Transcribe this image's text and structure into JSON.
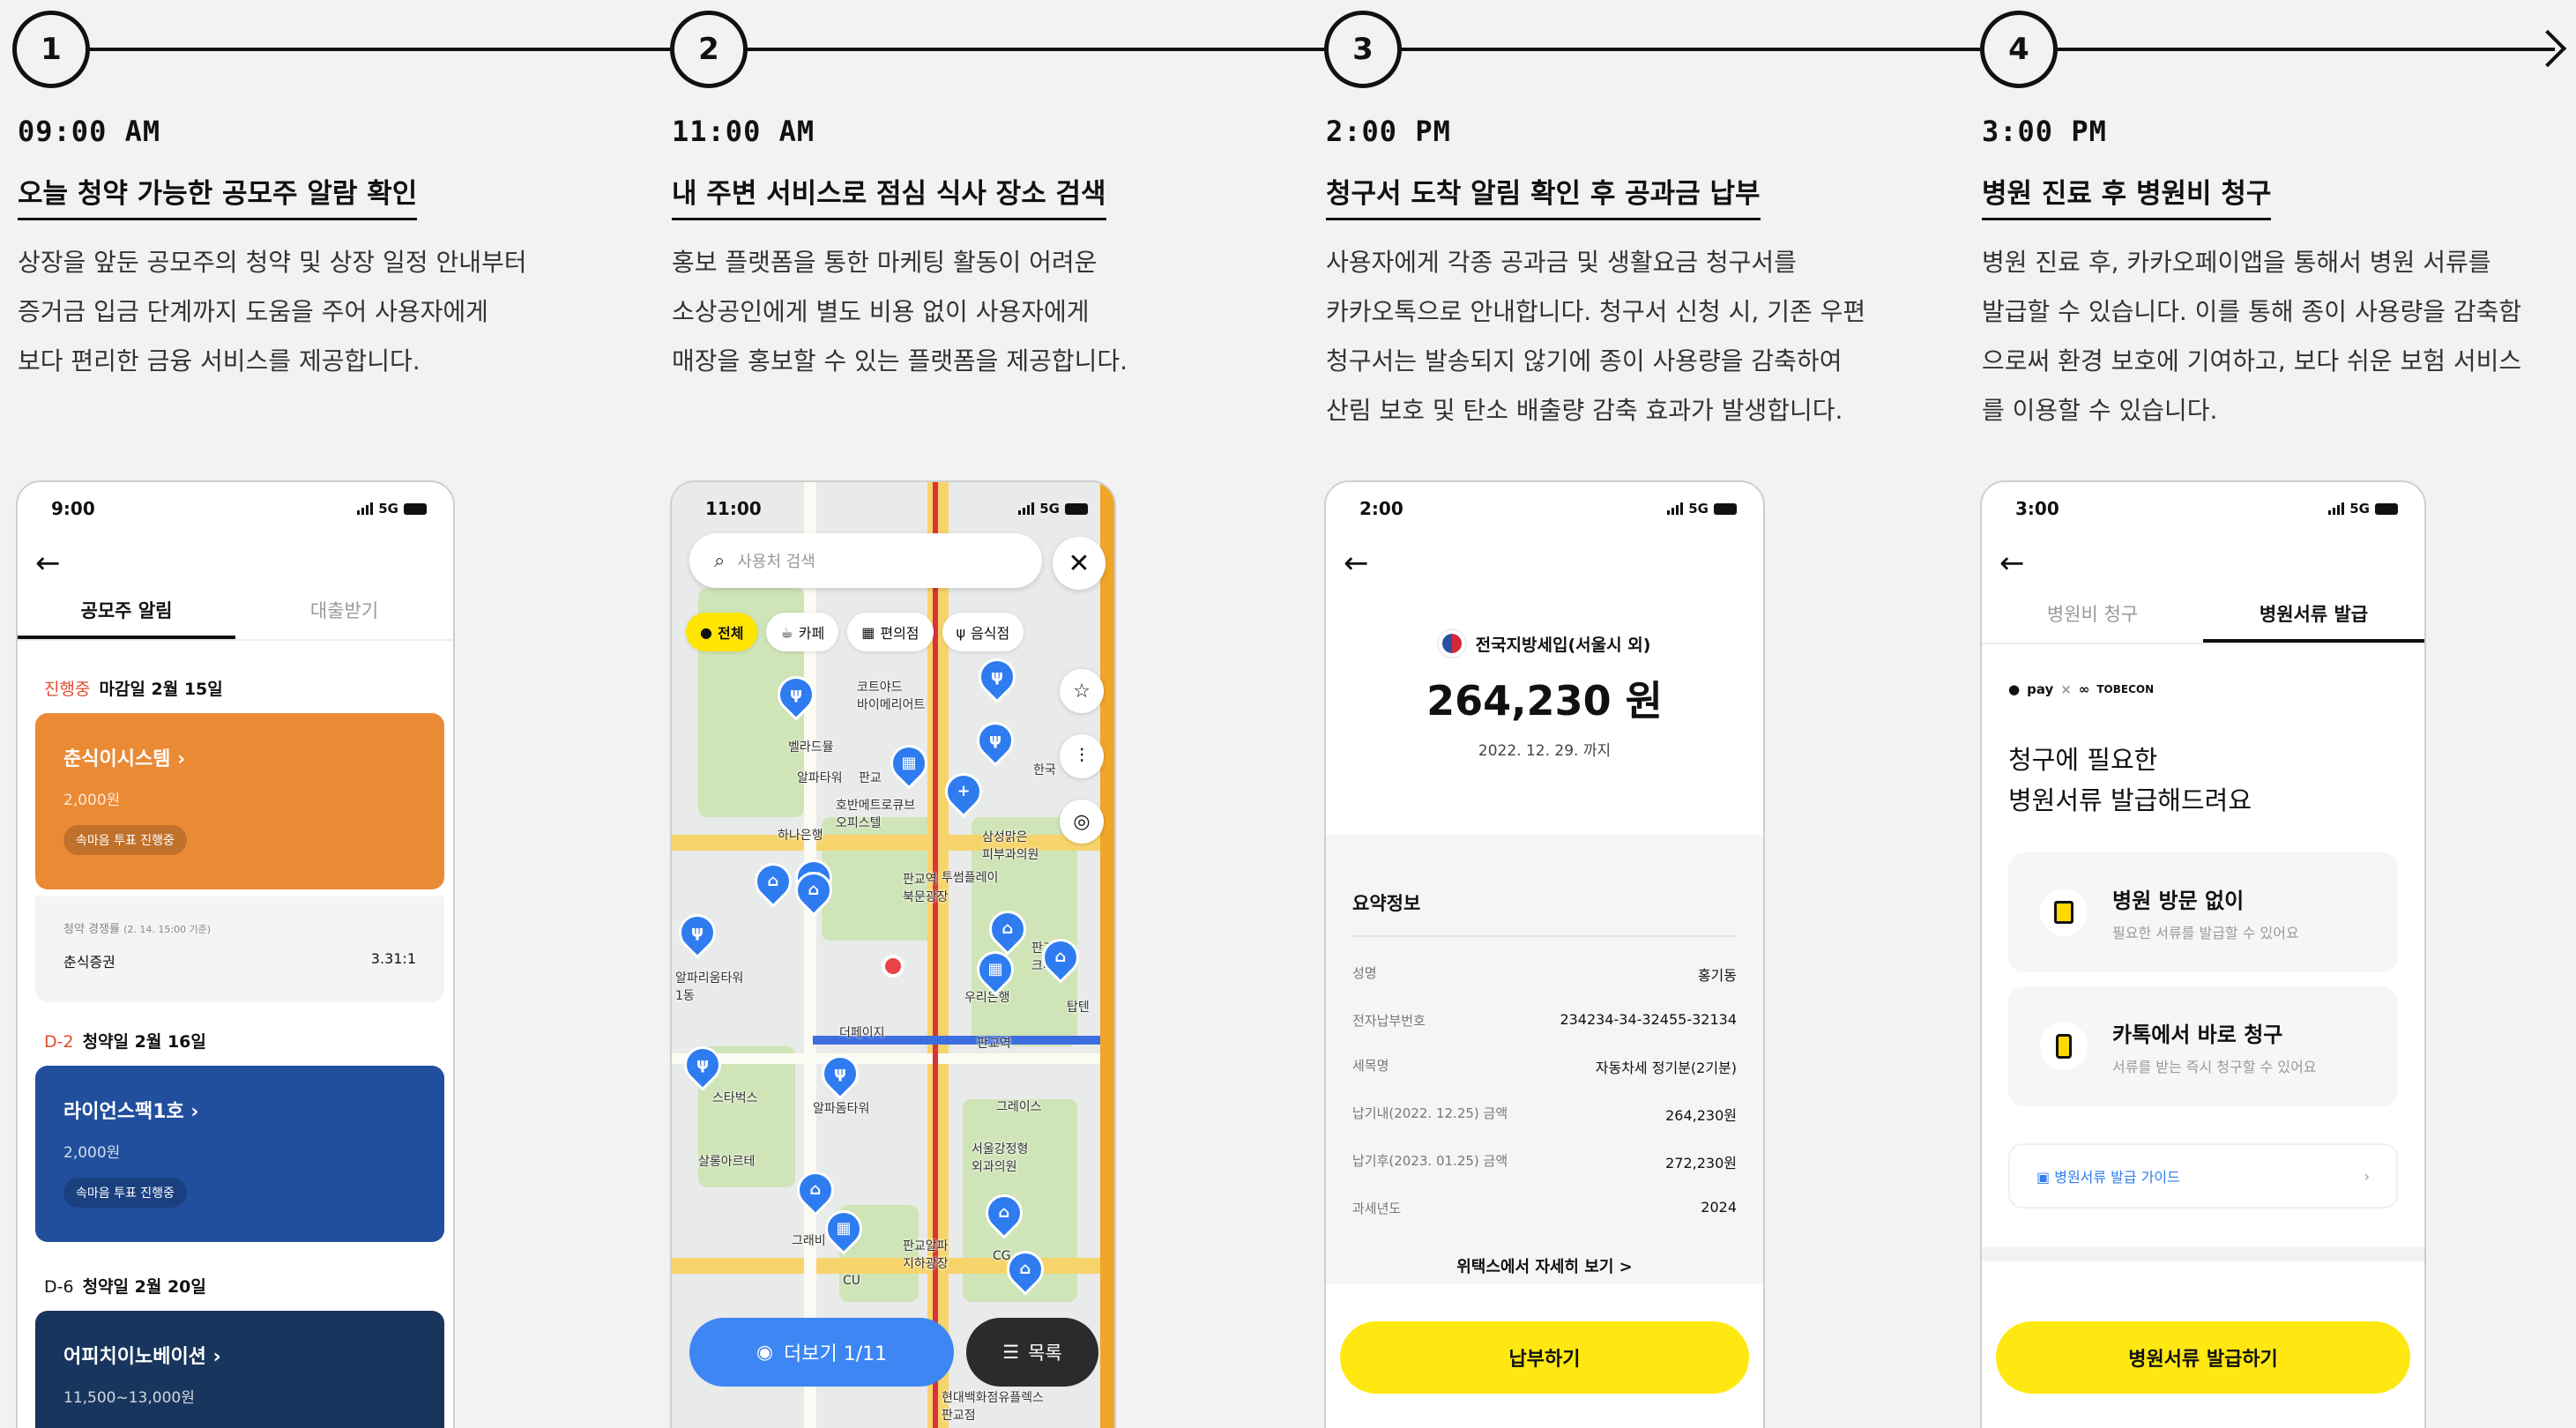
{
  "steps": [
    {
      "num": "1",
      "time": "09:00 AM",
      "title": "오늘 청약 가능한 공모주 알람 확인",
      "desc": [
        "상장을 앞둔 공모주의 청약 및 상장 일정 안내부터",
        "증거금 입금 단계까지 도움을 주어 사용자에게",
        "보다 편리한 금융 서비스를 제공합니다."
      ]
    },
    {
      "num": "2",
      "time": "11:00 AM",
      "title": "내 주변 서비스로 점심  식사 장소 검색",
      "desc": [
        "홍보 플랫폼을 통한 마케팅 활동이 어려운",
        "소상공인에게 별도 비용 없이 사용자에게",
        "매장을 홍보할 수 있는 플랫폼을 제공합니다."
      ]
    },
    {
      "num": "3",
      "time": "2:00 PM",
      "title": "청구서 도착 알림 확인 후 공과금 납부",
      "desc": [
        "사용자에게 각종 공과금 및 생활요금 청구서를",
        "카카오톡으로 안내합니다. 청구서 신청 시, 기존 우편",
        "청구서는 발송되지 않기에 종이 사용량을 감축하여",
        "산림 보호 및 탄소 배출량 감축 효과가 발생합니다."
      ]
    },
    {
      "num": "4",
      "time": "3:00 PM",
      "title": "병원 진료 후 병원비 청구",
      "desc": [
        "병원 진료 후, 카카오페이앱을 통해서 병원 서류를",
        "발급할 수 있습니다. 이를 통해 종이 사용량을 감축함",
        "으로써 환경 보호에 기여하고, 보다 쉬운 보험 서비스",
        "를 이용할 수 있습니다."
      ]
    }
  ],
  "status": {
    "net": "5G",
    "p1_time": "9:00",
    "p2_time": "11:00",
    "p3_time": "2:00",
    "p4_time": "3:00"
  },
  "phone1": {
    "tabs": [
      "공모주 알림",
      "대출받기"
    ],
    "groups": [
      {
        "tag": "진행중",
        "label": "마감일 2월 15일",
        "card": {
          "name": "춘식이시스템",
          "price": "2,000원",
          "chip": "속마음 투표 진행중",
          "color": "#eb8a35"
        }
      },
      {
        "tag": "D-2",
        "label": "청약일 2월 16일",
        "card": {
          "name": "라이언스팩1호",
          "price": "2,000원",
          "chip": "속마음 투표 진행중",
          "color": "#214f9d"
        }
      },
      {
        "tag": "D-6",
        "label": "청약일 2월 20일",
        "card": {
          "name": "어피치이노베이션",
          "price": "11,500~13,000원",
          "chip": "",
          "color": "#17355d"
        }
      }
    ],
    "competition": {
      "title": "청약 경쟁률",
      "note": "(2. 14. 15:00 기준)",
      "broker": "춘식증권",
      "ratio": "3.31:1"
    }
  },
  "phone2": {
    "search_placeholder": "사용처 검색",
    "filters": [
      "전체",
      "카페",
      "편의점",
      "음식점"
    ],
    "labels": [
      "코트야드 바이메리어트",
      "벨라드뮬",
      "알파타워",
      "판교",
      "호반메트로큐브 오피스텔",
      "하나은행",
      "삼성맑은 피부과의원",
      "판교역 북문광장",
      "투썸플레이",
      "알파리움타워 1동",
      "판교 크리",
      "우리은행",
      "탑텐",
      "더페이지",
      "판교역",
      "스타벅스",
      "알파돔타워",
      "그레이스",
      "서울강정형 외과의원",
      "살롱아르테",
      "그래비",
      "CU",
      "판교알파 지하광장",
      "CG",
      "한국",
      "현대백화점유플렉스 판교점"
    ],
    "more_label": "더보기 1/11",
    "list_label": "목록"
  },
  "phone3": {
    "issuer": "전국지방세입(서울시 외)",
    "amount": "264,230 원",
    "due": "2022. 12. 29. 까지",
    "summary_title": "요약정보",
    "rows": [
      {
        "k": "성명",
        "v": "홍기동"
      },
      {
        "k": "전자납부번호",
        "v": "234234-34-32455-32134"
      },
      {
        "k": "세목명",
        "v": "자동차세 정기분(2기분)"
      },
      {
        "k": "납기내(2022. 12.25) 금액",
        "v": "264,230원"
      },
      {
        "k": "납기후(2023. 01.25) 금액",
        "v": "272,230원"
      },
      {
        "k": "과세년도",
        "v": "2024"
      }
    ],
    "link": "위택스에서 자세히 보기 >",
    "pay_button": "납부하기"
  },
  "phone4": {
    "tabs": [
      "병원비 청구",
      "병원서류 발급"
    ],
    "logo_pay": "pay",
    "logo_partner": "TOBECON",
    "headline": [
      "청구에 필요한",
      "병원서류 발급해드려요"
    ],
    "boxes": [
      {
        "title": "병원 방문 없이",
        "sub": "필요한 서류를 발급할 수 있어요"
      },
      {
        "title": "카톡에서 바로 청구",
        "sub": "서류를 받는 즉시 청구할 수 있어요"
      }
    ],
    "guide": "병원서류 발급 가이드",
    "button": "병원서류 발급하기"
  },
  "colors": {
    "accent_yellow": "#ffe812",
    "pin_blue": "#2f7cf0",
    "alert_red": "#e24a2e"
  }
}
